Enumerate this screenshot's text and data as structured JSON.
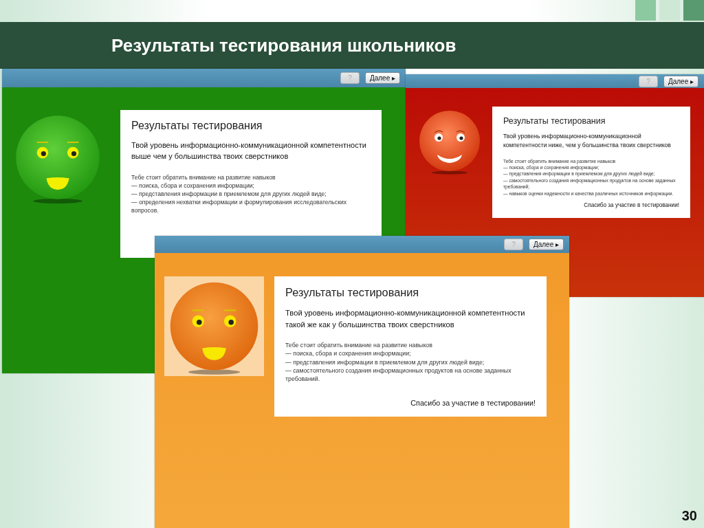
{
  "slide": {
    "title": "Результаты тестирования школьников",
    "page_number": "30"
  },
  "windows": [
    {
      "kind": "high",
      "help_button": {
        "label": "?",
        "disabled": true
      },
      "next_button": {
        "label": "Далее ▸"
      },
      "heading": "Результаты тестирования",
      "verdict": "Твой уровень информационно-коммуникационной компетентности выше чем у большинства твоих сверстников",
      "advice_intro": "Тебе стоит обратить внимание на развитие навыков",
      "advice_items": [
        "— поиска, сбора и сохранения информации;",
        "— представления информации в приемлемом для других людей виде;",
        "— определения нехватки информации и формулирования исследовательских вопросов."
      ]
    },
    {
      "kind": "low",
      "help_button": {
        "label": "?",
        "disabled": true
      },
      "next_button": {
        "label": "Далее ▸"
      },
      "heading": "Результаты тестирования",
      "verdict": "Твой уровень информационно-коммуникационной компетентности ниже, чем у большинства твоих сверстников",
      "advice_intro": "Тебе стоит обратить внимание на развитие навыков",
      "advice_items": [
        "— поиска, сбора и сохранения информации;",
        "— представления информации в приемлемом для других людей виде;",
        "— самостоятельного создания информационных продуктов на основе заданных требований;",
        "— навыков оценки надежности и качества различных источников информации."
      ],
      "thanks": "Спасибо за участие в тестировании!"
    },
    {
      "kind": "average",
      "help_button": {
        "label": "?",
        "disabled": true
      },
      "next_button": {
        "label": "Далее ▸"
      },
      "heading": "Результаты тестирования",
      "verdict": "Твой уровень информационно-коммуникационной компетентности такой же как у большинства твоих сверстников",
      "advice_intro": "Тебе стоит обратить внимание на развитие навыков",
      "advice_items": [
        "— поиска, сбора и сохранения информации;",
        "— представления информации в приемлемом для других людей виде;",
        "— самостоятельного создания информационных продуктов на основе заданных требований."
      ],
      "thanks": "Спасибо за участие в тестировании!"
    }
  ]
}
